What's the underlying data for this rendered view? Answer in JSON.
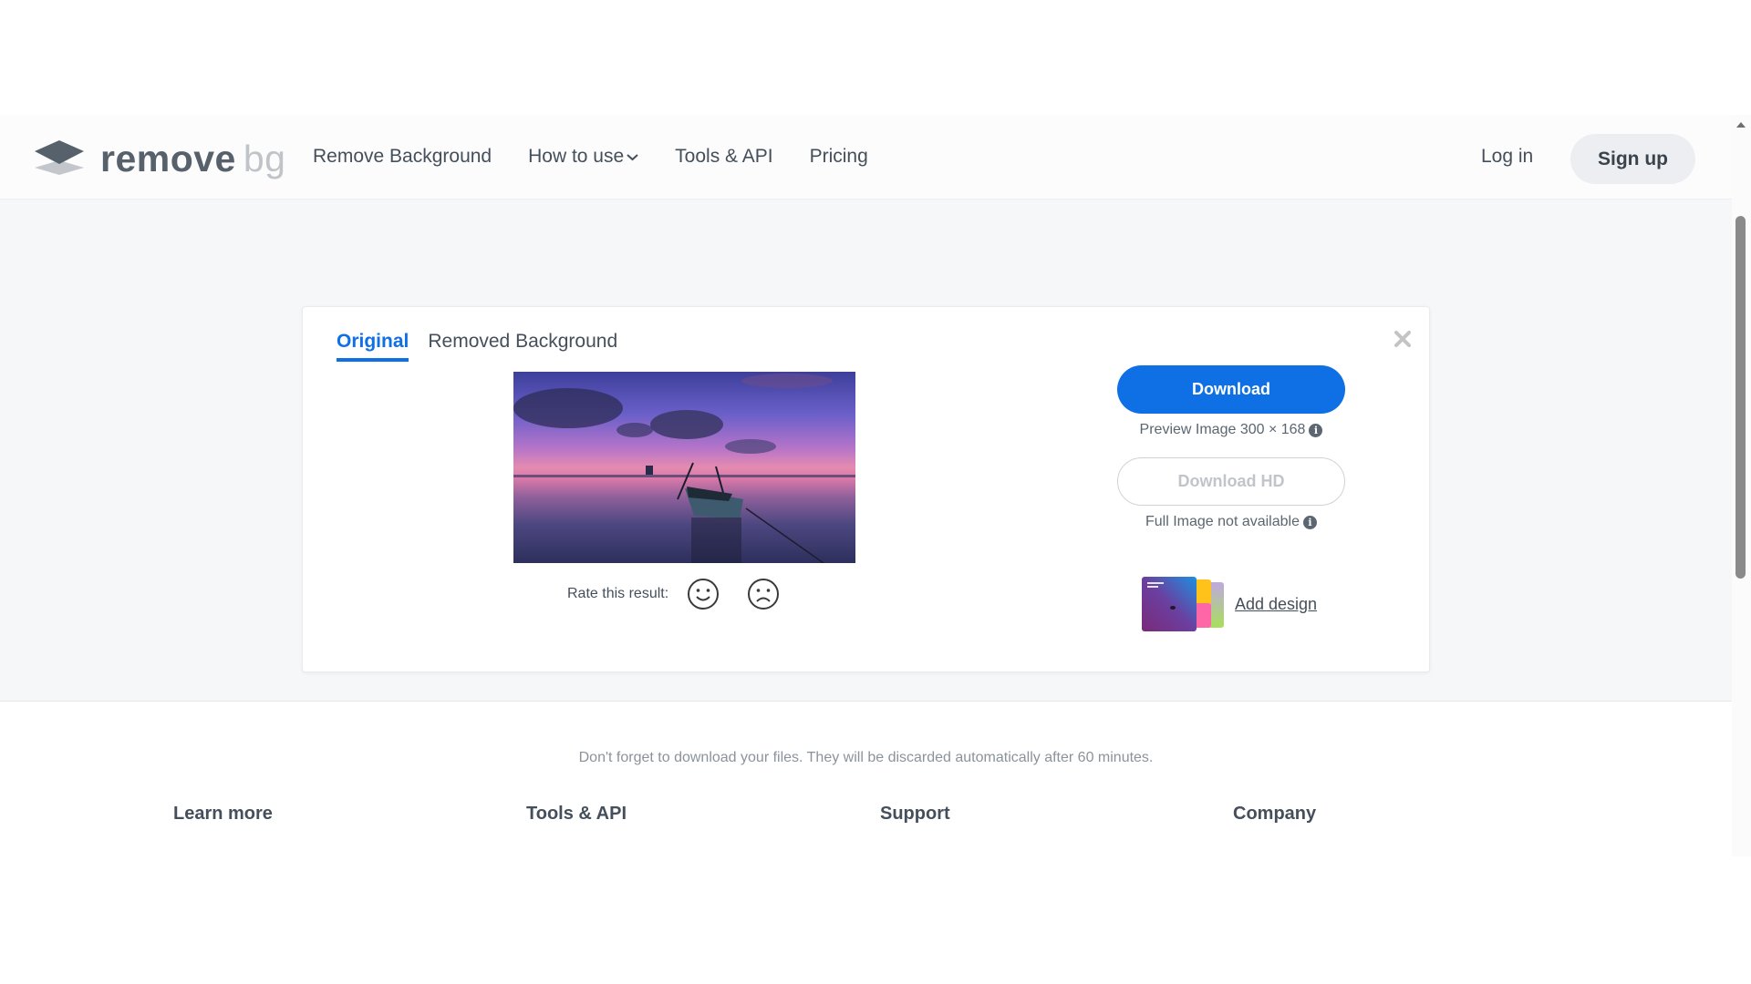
{
  "brand": {
    "word1": "remove",
    "word2": "bg"
  },
  "nav": {
    "items": [
      {
        "label": "Remove Background"
      },
      {
        "label": "How to use",
        "has_dropdown": true
      },
      {
        "label": "Tools & API"
      },
      {
        "label": "Pricing"
      }
    ],
    "login_label": "Log in",
    "signup_label": "Sign up"
  },
  "result": {
    "tabs": [
      {
        "label": "Original",
        "active": true
      },
      {
        "label": "Removed Background",
        "active": false
      }
    ],
    "close_icon": "close-icon",
    "rate_label": "Rate this result:",
    "rate_icons": [
      "smile-icon",
      "frown-icon"
    ],
    "download_label": "Download",
    "preview_note": "Preview Image 300 × 168",
    "download_hd_label": "Download HD",
    "hd_note": "Full Image not available",
    "add_design_label": "Add design",
    "colors": {
      "accent": "#0f70e6"
    }
  },
  "reminder": "Don't forget to download your files. They will be discarded automatically after 60 minutes.",
  "footer": {
    "headings": [
      "Learn more",
      "Tools & API",
      "Support",
      "Company"
    ]
  }
}
